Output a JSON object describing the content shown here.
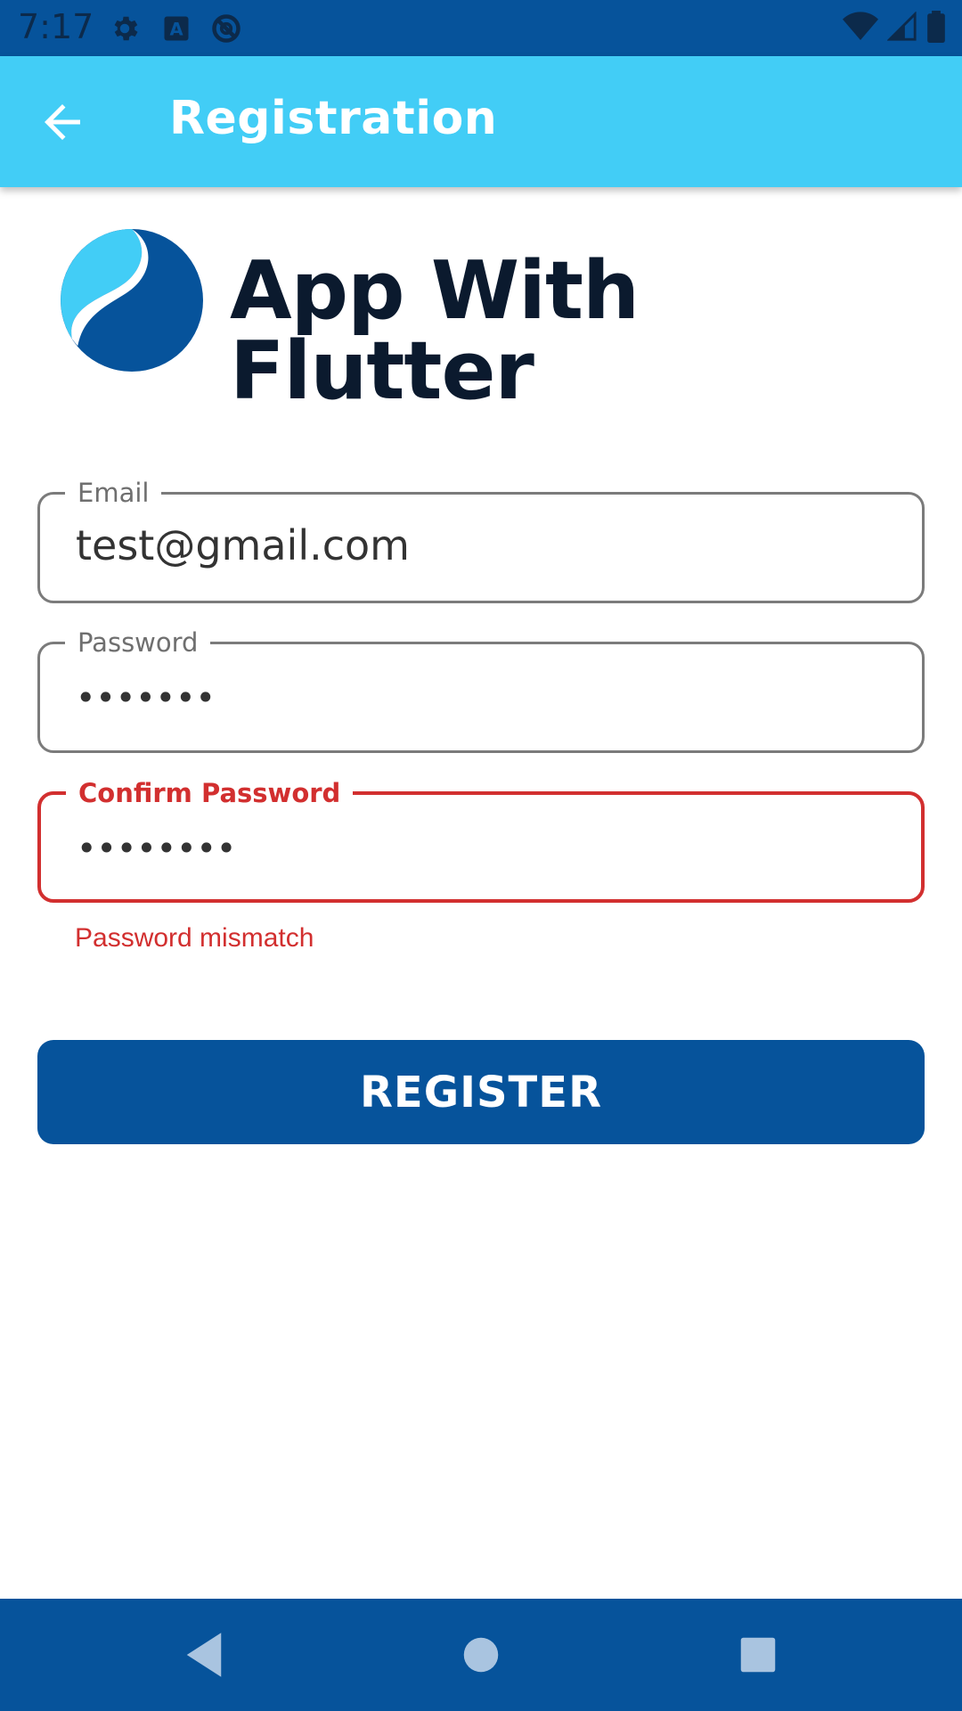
{
  "status_bar": {
    "time": "7:17",
    "left_icons": [
      "settings-icon",
      "keyboard-a-icon",
      "do-not-disturb-icon"
    ],
    "right_icons": [
      "wifi-icon",
      "signal-icon",
      "battery-icon"
    ]
  },
  "app_bar": {
    "title": "Registration",
    "back_icon": "arrow-back-icon"
  },
  "logo": {
    "text": "App With Flutter",
    "colors": {
      "light": "#42cdf6",
      "dark": "#06539b"
    }
  },
  "form": {
    "email": {
      "label": "Email",
      "value": "test@gmail.com"
    },
    "password": {
      "label": "Password",
      "value": "•••••••"
    },
    "confirm_password": {
      "label": "Confirm Password",
      "value": "••••••••",
      "error": "Password mismatch"
    }
  },
  "register_button": {
    "label": "REGISTER"
  },
  "nav_bar": {
    "items": [
      "back-triangle-icon",
      "home-circle-icon",
      "recents-square-icon"
    ]
  },
  "colors": {
    "primary": "#06539b",
    "accent": "#42cdf6",
    "error": "#d22f2f"
  }
}
